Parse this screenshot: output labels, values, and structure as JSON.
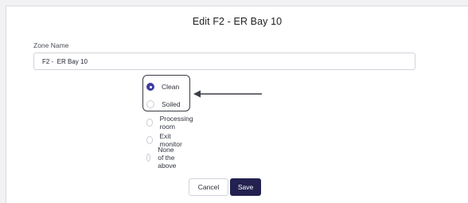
{
  "dialog": {
    "title": "Edit F2 - ER Bay 10"
  },
  "zone_name": {
    "label": "Zone Name",
    "value": "F2 -  ER Bay 10"
  },
  "zone_type": {
    "options": [
      {
        "label": "Clean",
        "checked": true
      },
      {
        "label": "Soiled",
        "checked": false
      },
      {
        "label": "Processing room",
        "checked": false
      },
      {
        "label": "Exit monitor",
        "checked": false
      },
      {
        "label": "None of the above",
        "checked": false
      }
    ]
  },
  "actions": {
    "cancel_label": "Cancel",
    "save_label": "Save"
  },
  "colors": {
    "accent": "#3f3d9e",
    "save_button": "#23214f",
    "annotation": "#3a3d45"
  }
}
